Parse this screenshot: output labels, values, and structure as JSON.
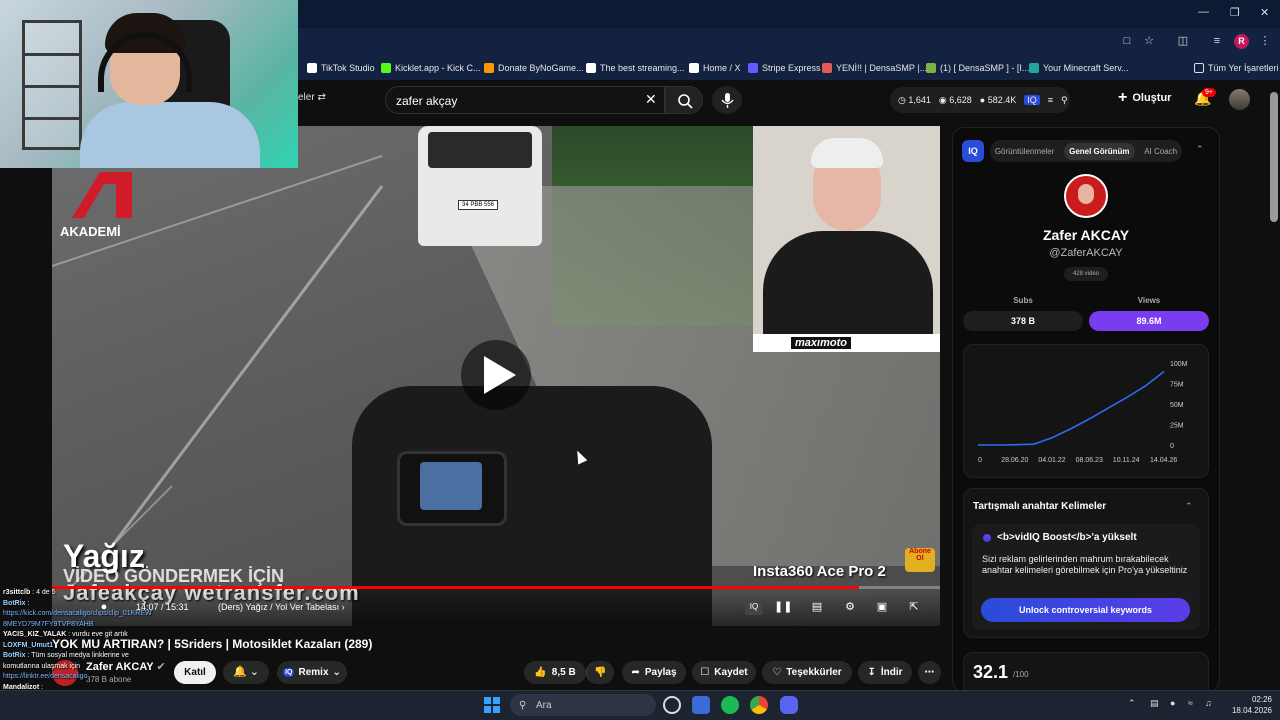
{
  "browser": {
    "bookmarks": [
      {
        "label": "TikTok Studio",
        "icon": "tiktok-icon",
        "color": "#ffffff"
      },
      {
        "label": "Kicklet.app - Kick C...",
        "icon": "kicklet-icon",
        "color": "#53fc18"
      },
      {
        "label": "Donate ByNoGame...",
        "icon": "bynogame-icon",
        "color": "#ff9800"
      },
      {
        "label": "The best streaming...",
        "icon": "streaming-icon",
        "color": "#ffffff"
      },
      {
        "label": "Home / X",
        "icon": "x-icon",
        "color": "#ffffff"
      },
      {
        "label": "Stripe Express",
        "icon": "stripe-icon",
        "color": "#635bff"
      },
      {
        "label": "YENİ!! | DensaSMP |...",
        "icon": "densa-icon",
        "color": "#e05a5a"
      },
      {
        "label": "(1) [ DensaSMP ] - [I...",
        "icon": "densa2-icon",
        "color": "#7cb342"
      },
      {
        "label": "Your Minecraft Serv...",
        "icon": "minecraft-icon",
        "color": "#26a69a"
      }
    ],
    "all_bookmarks": "Tüm Yer İşaretleri",
    "profile_initial": "R"
  },
  "masthead": {
    "filters_label": "eler",
    "search_value": "zafer akçay",
    "stats": [
      "1,641",
      "6,628",
      "582.4K"
    ],
    "create_label": "Oluştur",
    "notif_badge": "9+"
  },
  "video": {
    "logo_text": "AKADEMİ",
    "pip_brand": "maxımoto",
    "overlay_name": "Yağız",
    "overlay_watermark": "Jafeakçay wetransfer.com",
    "overlay_subtitle": "VİDEO GÖNDERMEK İÇİN",
    "sponsor": "Insta360 Ace Pro 2",
    "abone": "Abone Ol",
    "plate": "34 PBB 556",
    "time": "14:07 / 15:31",
    "chapter": "(Ders) Yağız / Yol Ver Tabelası",
    "progress_percent": 90.9
  },
  "watch": {
    "title": "YOK MU ARTIRAN? | 5Sriders | Motosiklet Kazaları (289)",
    "channel_name": "Zafer AKCAY",
    "subscribers": "378 B abone",
    "join_label": "Katıl",
    "remix_label": "Remix",
    "likes": "8,5 B",
    "share_label": "Paylaş",
    "save_label": "Kaydet",
    "thanks_label": "Teşekkürler",
    "download_label": "İndir"
  },
  "chat": {
    "lines": [
      {
        "user": "r3sittclb",
        "text": ": 4 de 5",
        "color": "#ffffff"
      },
      {
        "user": "BotRix",
        "text": ":",
        "color": "#9ad0ff"
      },
      {
        "user": "",
        "text": "https://kick.com/densacaligo/clips/clip_01KREW",
        "color": "#7ab3ff"
      },
      {
        "user": "",
        "text": "8MEYD79M7FY9TVP8YAHB",
        "color": "#7ab3ff"
      },
      {
        "user": "YACIS_KIZ_YALAK",
        "text": ": vurdu eve git artık",
        "color": "#ffffff"
      },
      {
        "user": "LOXFM_Umut1",
        "text": ":",
        "color": "#9ad0ff"
      },
      {
        "user": "BotRix",
        "text": ": Tüm sosyal medya linklerine ve",
        "color": "#9ad0ff"
      },
      {
        "user": "",
        "text": "komutlarına ulaşmak için",
        "color": "#ffffff"
      },
      {
        "user": "",
        "text": "https://linktr.ee/densacaligo",
        "color": "#7ab3ff"
      },
      {
        "user": "Mandalizot",
        "text": ":",
        "color": "#ffffff"
      }
    ]
  },
  "vidiq": {
    "tabs": [
      "Görüntülenmeler",
      "Genel Görünüm",
      "AI Coach"
    ],
    "active_tab": "Genel Görünüm",
    "logo": "IQ",
    "channel_name": "Zafer AKCAY",
    "handle": "@ZaferAKCAY",
    "video_count": "428 video",
    "subs_label": "Subs",
    "views_label": "Views",
    "subs_value": "378 B",
    "views_value": "89.6M",
    "keywords_title": "Tartışmalı anahtar Kelimeler",
    "boost_text": "<b>vidIQ Boost</b>'a yükselt",
    "keywords_desc": "Sizi reklam gelirlerinden mahrum bırakabilecek anahtar kelimeleri görebilmek için Pro'ya yükseltiniz",
    "unlock_label": "Unlock controversial keywords",
    "score": "32.1",
    "score_max": "/100"
  },
  "chart_data": {
    "type": "area",
    "x_labels": [
      "0",
      "28.06.20",
      "04.01.22",
      "08.06.23",
      "10.11.24",
      "14.04.26"
    ],
    "y_ticks": [
      "100M",
      "75M",
      "50M",
      "25M",
      "0"
    ],
    "ylim": [
      0,
      100
    ],
    "x": [
      0,
      0.15,
      0.3,
      0.4,
      0.5,
      0.6,
      0.7,
      0.8,
      0.9,
      1.0
    ],
    "values": [
      0,
      0,
      1,
      9,
      20,
      32,
      45,
      58,
      72,
      89.6
    ],
    "color": "#2a6cf0"
  },
  "taskbar": {
    "search_label": "Ara",
    "time": "02:26",
    "date": "18.04.2026"
  }
}
